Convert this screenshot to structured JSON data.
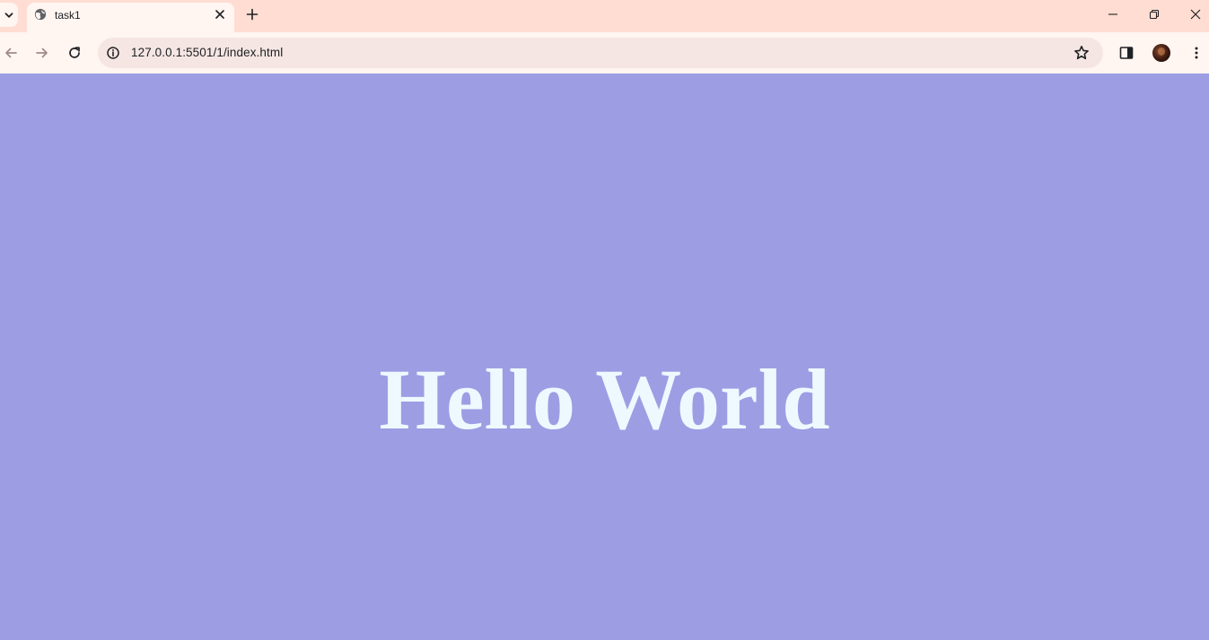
{
  "browser": {
    "tab": {
      "title": "task1"
    },
    "address_bar": {
      "url": "127.0.0.1:5501/1/index.html"
    }
  },
  "page": {
    "heading": "Hello World",
    "background_color": "#9d9de4",
    "heading_color": "#eef9ff"
  },
  "icons": {
    "tab_search": "chevron-down-icon",
    "favicon": "globe-icon",
    "tab_close": "close-icon",
    "new_tab": "plus-icon",
    "minimize": "minimize-icon",
    "restore": "restore-icon",
    "window_close": "close-icon",
    "back": "back-arrow-icon",
    "forward": "forward-arrow-icon",
    "reload": "reload-icon",
    "site_info": "info-icon",
    "bookmark": "star-icon",
    "side_panel": "side-panel-icon",
    "menu": "kebab-menu-icon"
  }
}
